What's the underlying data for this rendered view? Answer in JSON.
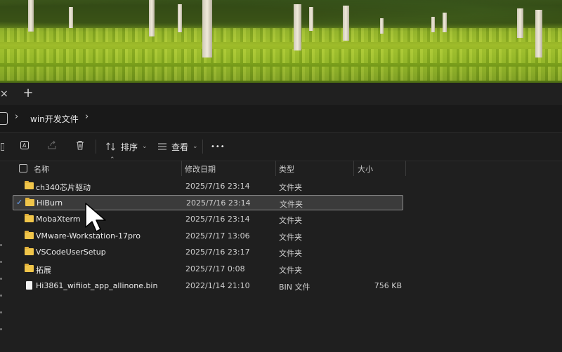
{
  "tabs": {
    "close_icon": "×",
    "new_tab_icon": "+"
  },
  "address": {
    "path": "win开发文件"
  },
  "toolbar": {
    "sort_label": "排序",
    "view_label": "查看",
    "more_label": "•••"
  },
  "columns": {
    "name": "名称",
    "modified": "修改日期",
    "type": "类型",
    "size": "大小"
  },
  "files": [
    {
      "name": "ch340芯片驱动",
      "modified": "2025/7/16 23:14",
      "type": "文件夹",
      "size": "",
      "icon": "folder-icon"
    },
    {
      "name": "HiBurn",
      "modified": "2025/7/16 23:14",
      "type": "文件夹",
      "size": "",
      "icon": "folder-icon",
      "selected": true
    },
    {
      "name": "MobaXterm",
      "modified": "2025/7/16 23:14",
      "type": "文件夹",
      "size": "",
      "icon": "folder-icon"
    },
    {
      "name": "VMware-Workstation-17pro",
      "modified": "2025/7/17 13:06",
      "type": "文件夹",
      "size": "",
      "icon": "folder-icon"
    },
    {
      "name": "VSCodeUserSetup",
      "modified": "2025/7/16 23:17",
      "type": "文件夹",
      "size": "",
      "icon": "folder-icon"
    },
    {
      "name": "拓展",
      "modified": "2025/7/17 0:08",
      "type": "文件夹",
      "size": "",
      "icon": "folder-icon"
    },
    {
      "name": "Hi3861_wifiiot_app_allinone.bin",
      "modified": "2022/1/14 21:10",
      "type": "BIN 文件",
      "size": "756 KB",
      "icon": "file-icon"
    }
  ],
  "colors": {
    "folder": "#f0c54a",
    "selection": "#3b3b3b",
    "accent": "#69a7ff"
  }
}
